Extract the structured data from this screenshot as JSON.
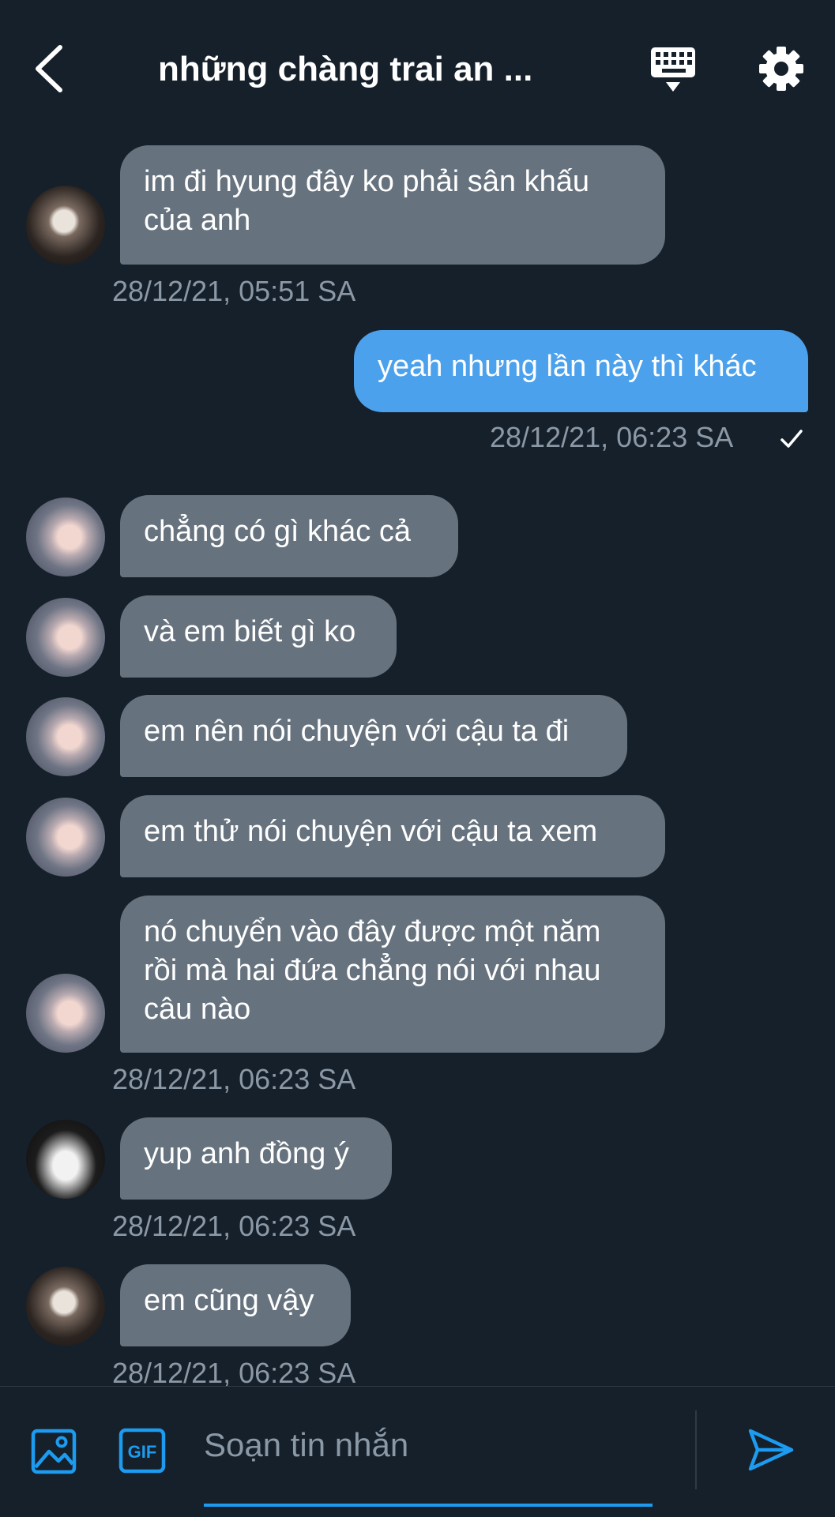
{
  "header": {
    "title": "những chàng trai an ...",
    "back_icon": "chevron-left-icon",
    "keyboard_icon": "keyboard-icon",
    "settings_icon": "gear-icon"
  },
  "messages": [
    {
      "direction": "in",
      "text": "im đi hyung đây ko phải sân khấu của anh",
      "timestamp": "28/12/21, 05:51 SA"
    },
    {
      "direction": "out",
      "text": "yeah nhưng lần này thì khác",
      "timestamp": "28/12/21, 06:23 SA",
      "status": "sent-check-icon"
    },
    {
      "direction": "in",
      "text": "chẳng có gì khác cả"
    },
    {
      "direction": "in",
      "text": "và em biết gì ko"
    },
    {
      "direction": "in",
      "text": "em nên nói chuyện với cậu ta đi"
    },
    {
      "direction": "in",
      "text": "em thử nói chuyện với cậu ta xem"
    },
    {
      "direction": "in",
      "text": "nó chuyển vào đây được một năm rồi mà hai đứa chẳng nói với nhau câu nào",
      "timestamp": "28/12/21, 06:23 SA"
    },
    {
      "direction": "in",
      "text": "yup anh đồng ý",
      "timestamp": "28/12/21, 06:23 SA"
    },
    {
      "direction": "in",
      "text": "em cũng vậy",
      "timestamp": "28/12/21, 06:23 SA"
    }
  ],
  "composer": {
    "placeholder": "Soạn tin nhắn",
    "value": "",
    "image_icon": "image-icon",
    "gif_icon": "gif-icon",
    "gif_label": "GIF",
    "send_icon": "send-icon"
  },
  "colors": {
    "background": "#15202b",
    "incoming_bubble": "#66727e",
    "outgoing_bubble": "#4ba1ec",
    "accent": "#1d9bf0",
    "muted_text": "#8b98a5"
  }
}
